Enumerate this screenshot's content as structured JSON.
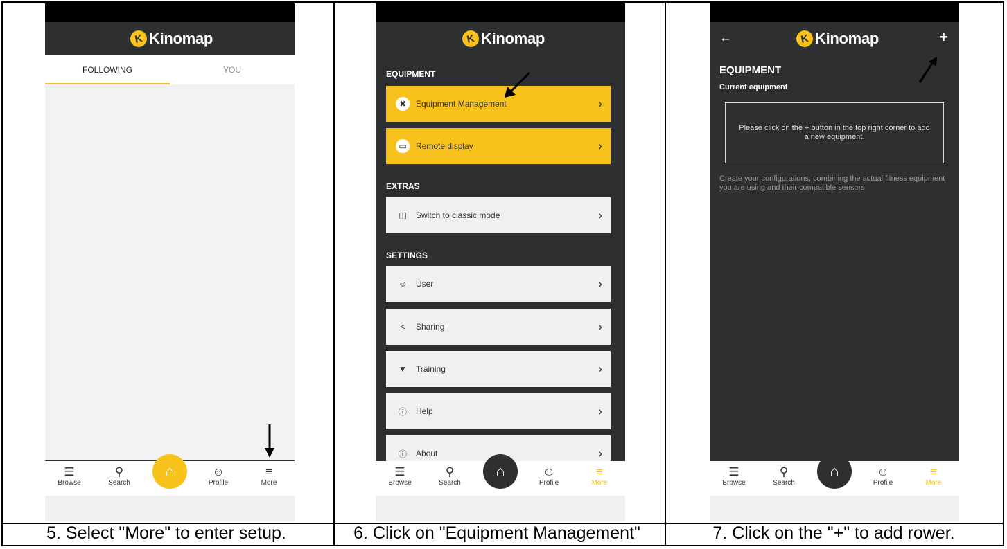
{
  "app": {
    "logo_letter": "K",
    "logo_text": "Kinomap"
  },
  "colors": {
    "accent": "#f8c21d",
    "dark_bg": "#2e2f31",
    "feed_bg": "#f2f2f2"
  },
  "captions": [
    "5. Select \"More\" to enter setup.",
    "6. Click on \"Equipment Management\"",
    "7. Click on the \"+\" to add rower."
  ],
  "panel1": {
    "tabs": [
      {
        "label": "FOLLOWING",
        "active": true
      },
      {
        "label": "YOU",
        "active": false
      }
    ]
  },
  "nav": {
    "items": [
      {
        "label": "Browse",
        "icon": "browse-icon"
      },
      {
        "label": "Search",
        "icon": "search-icon"
      },
      {
        "label": "Profile",
        "icon": "profile-icon"
      },
      {
        "label": "More",
        "icon": "menu-icon"
      }
    ],
    "home_icon": "home-icon"
  },
  "panel2": {
    "sections": [
      {
        "title": "EQUIPMENT"
      },
      {
        "title": "EXTRAS"
      },
      {
        "title": "SETTINGS"
      }
    ],
    "items": [
      {
        "label": "Equipment Management",
        "icon": "tools-icon"
      },
      {
        "label": "Remote display",
        "icon": "display-icon"
      },
      {
        "label": "Switch to classic mode",
        "icon": "switch-icon"
      },
      {
        "label": "User",
        "icon": "user-icon"
      },
      {
        "label": "Sharing",
        "icon": "share-icon"
      },
      {
        "label": "Training",
        "icon": "trophy-icon"
      },
      {
        "label": "Help",
        "icon": "help-icon"
      },
      {
        "label": "About",
        "icon": "info-icon"
      }
    ]
  },
  "panel3": {
    "back_icon": "back-arrow-icon",
    "add_icon": "plus-icon",
    "title": "EQUIPMENT",
    "subtitle": "Current equipment",
    "empty_message": "Please click on the + button in the top right corner to add a new equipment.",
    "description": "Create your configurations, combining the actual fitness equipment you are using and their compatible sensors"
  }
}
